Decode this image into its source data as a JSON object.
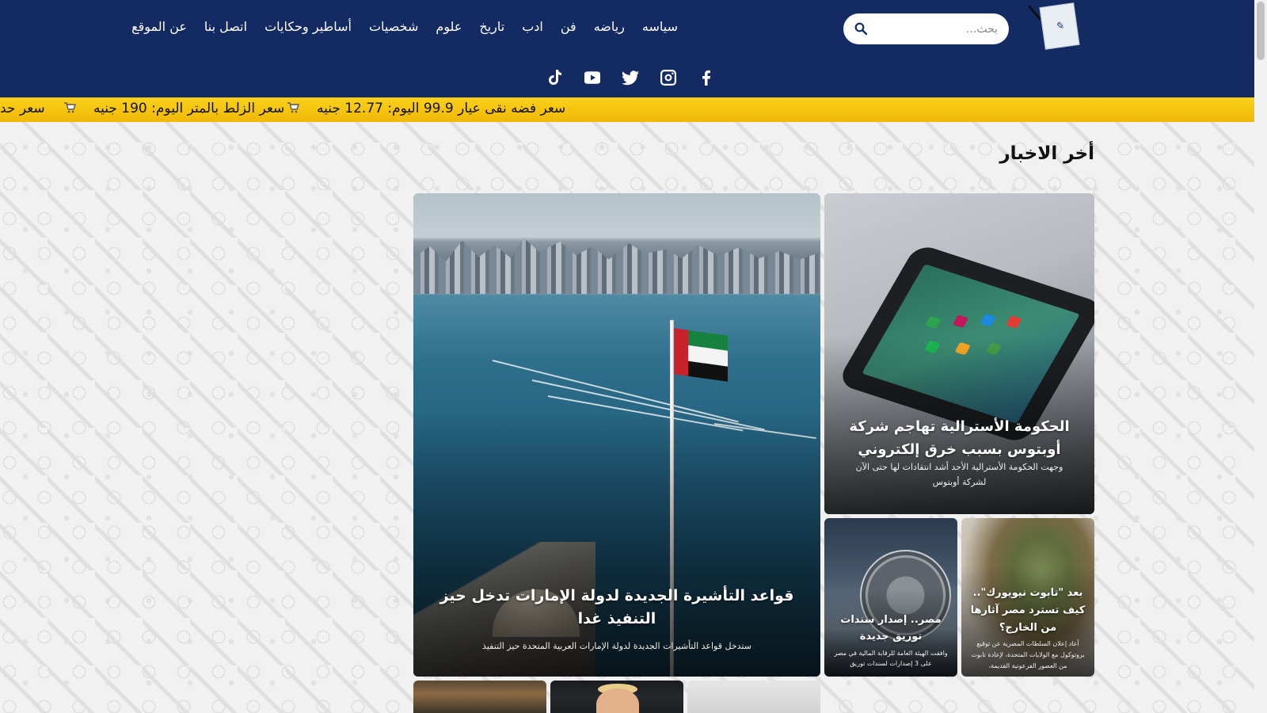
{
  "header": {
    "search_placeholder": "بحث...",
    "nav": [
      {
        "label": "سياسه"
      },
      {
        "label": "رياضه"
      },
      {
        "label": "فن"
      },
      {
        "label": "ادب"
      },
      {
        "label": "تاريخ"
      },
      {
        "label": "علوم"
      },
      {
        "label": "شخصيات"
      },
      {
        "label": "أساطير وحكايات"
      },
      {
        "label": "اتصل بنا"
      },
      {
        "label": "عن الموقع"
      }
    ],
    "social": [
      "facebook-icon",
      "instagram-icon",
      "twitter-icon",
      "youtube-icon",
      "tiktok-icon"
    ],
    "colors": {
      "header_bg": "#132a62",
      "ticker_bg": "#f5c40c"
    }
  },
  "ticker": {
    "items": [
      "سعر فضه نقى عيار 99.9 اليوم: 12.77 جنيه",
      "سعر الزلط بالمتر اليوم: 190 جنيه",
      "سعر حد"
    ]
  },
  "section": {
    "title": "أخر الاخبار"
  },
  "articles": {
    "phone": {
      "title": "الحكومة الأسترالية تهاجم شركة أوبتوس بسبب خرق إلكتروني",
      "excerpt": "وجهت الحكومة الأسترالية الأحد أشد انتقادات لها حتى الآن لشركة أوبتوس"
    },
    "uae": {
      "title": "قواعد التأشيرة الجديدة لدولة الإمارات تدخل حيز التنفيذ غدا",
      "excerpt": "ستدخل قواعد التأشيرات الجديدة لدولة الإمارات العربية المتحدة حيز التنفيذ"
    },
    "coffin": {
      "title": "بعد \"تابوت نيويورك\".. كيف تسترد مصر آثارها من الخارج؟",
      "excerpt": "أعاد إعلان السلطات المصرية عن توقيع بروتوكول مع الولايات المتحدة، لإعادة تابوت من العصور الفرعونية القديمة،"
    },
    "finance": {
      "title": "مصر.. إصدار سندات توريق جديدة",
      "excerpt": "وافقت الهيئة العامة للرقابة المالية في مصر على 3 إصدارات لسندات توريق"
    }
  }
}
